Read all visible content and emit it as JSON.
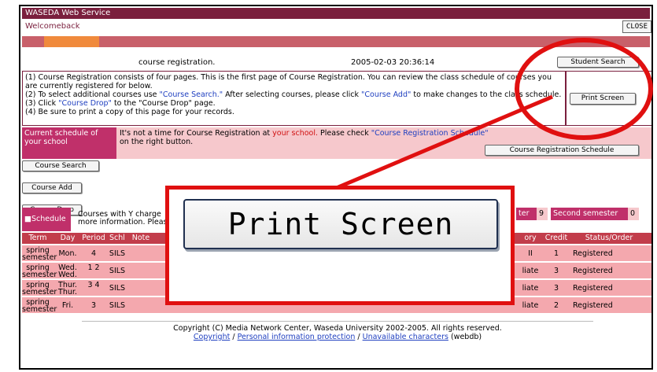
{
  "app": {
    "title": "WASEDA Web Service",
    "welcome": "Welcomeback",
    "close_label": "CLOSE"
  },
  "info": {
    "page": "course registration.",
    "timestamp": "2005-02-03 20:36:14",
    "student_search": "Student Search",
    "print_screen": "Print Screen"
  },
  "instructions": {
    "line1": "(1) Course Registration consists of four pages. This is the first page of Course Registration. You can review the class schedule of courses you are currently registered for below.",
    "line2a": "(2) To select additional courses use ",
    "line2b": "\"Course Search.\"",
    "line2c": " After selecting courses, please click ",
    "line2d": "\"Course Add\"",
    "line2e": " to make changes to the class schedule.",
    "line3a": "(3) Click ",
    "line3b": "\"Course Drop\"",
    "line3c": " to the \"Course Drop\" page.",
    "line4": "(4) Be sure to print a copy of this page for your records."
  },
  "schedule_notice": {
    "heading": "Current schedule of your school",
    "text_a": "It's not a time for Course Registration at ",
    "text_red": "your school.",
    "text_b": " Please check ",
    "text_link": "\"Course Registration Schedule\"",
    "text_c": " on the right button.",
    "button": "Course Registration Schedule"
  },
  "actions": {
    "course_search": "Course Search",
    "course_add": "Course Add",
    "course_drop": "Course Drop"
  },
  "table_top": {
    "schedule_tab": "Schedule",
    "note_line1": "Courses with Y charge",
    "note_line2": "more information. Pleas",
    "first_sem_label": "ter",
    "first_sem_count": "9",
    "second_sem_label": "Second semester",
    "second_sem_count": "0"
  },
  "table": {
    "headers": [
      "Term",
      "Day",
      "Period",
      "Schl",
      "Note",
      "ory",
      "Credit",
      "Status/Order"
    ],
    "rows": [
      {
        "term": "spring semester",
        "day": "Mon.",
        "period": "4",
        "schl": "SILS",
        "cat": "II",
        "credit": "1",
        "status": "Registered"
      },
      {
        "term": "spring semester",
        "day": "Wed. Wed.",
        "period": "1 2",
        "schl": "SILS",
        "cat": "liate",
        "credit": "3",
        "status": "Registered"
      },
      {
        "term": "spring semester",
        "day": "Thur. Thur.",
        "period": "3 4",
        "schl": "SILS",
        "cat": "liate",
        "credit": "3",
        "status": "Registered"
      },
      {
        "term": "spring semester",
        "day": "Fri.",
        "period": "3",
        "schl": "SILS",
        "cat": "liate",
        "credit": "2",
        "status": "Registered"
      }
    ]
  },
  "footer": {
    "copyright": "Copyright (C) Media Network Center, Waseda University 2002-2005. All rights reserved.",
    "link_copyright": "Copyright",
    "link_privacy": "Personal information protection",
    "link_unavailable": "Unavailable characters",
    "suffix": "(webdb)",
    "sep": " / "
  },
  "overlay": {
    "zoomed_label": "Print Screen"
  },
  "colors": {
    "title_bar": "#7a1f3d",
    "accent_red": "#e01010",
    "table_header": "#c23d4b",
    "table_row": "#f4a8ae"
  }
}
